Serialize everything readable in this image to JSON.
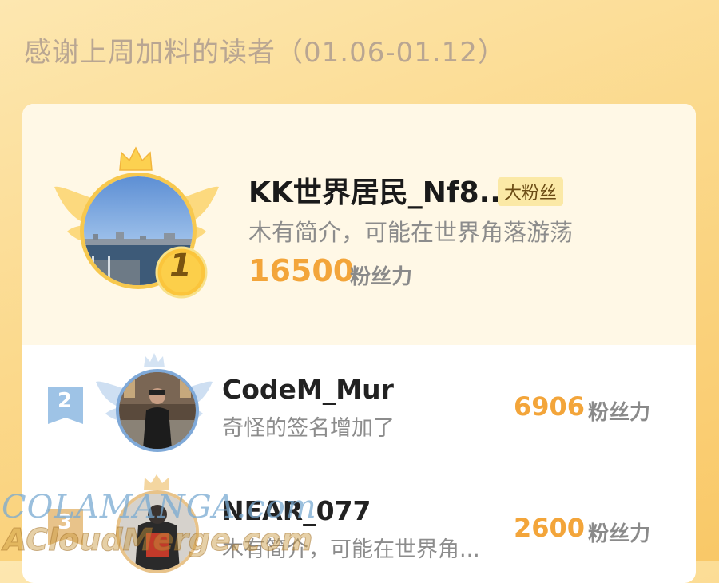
{
  "header": {
    "title": "感谢上周加料的读者（01.06-01.12）"
  },
  "top_fan": {
    "rank": "1",
    "name": "KK世界居民_Nf8...",
    "tag": "大粉丝",
    "bio": "木有简介，可能在世界角落游荡",
    "score": "16500",
    "score_unit": "粉丝力"
  },
  "fans": [
    {
      "rank": "2",
      "name": "CodeM_Mur",
      "bio": "奇怪的签名增加了",
      "score": "6906",
      "score_unit": "粉丝力"
    },
    {
      "rank": "3",
      "name": "NEAR_077",
      "bio": "木有简介，可能在世界角...",
      "score": "2600",
      "score_unit": "粉丝力"
    }
  ],
  "watermark": {
    "line1": "COLAMANGA.com",
    "line2": "ACloudMerge.com"
  },
  "colors": {
    "gold": "#f3a53a",
    "silver": "#9ec3e6",
    "background_top": "#fde7b0",
    "background_bottom": "#f9c867"
  }
}
